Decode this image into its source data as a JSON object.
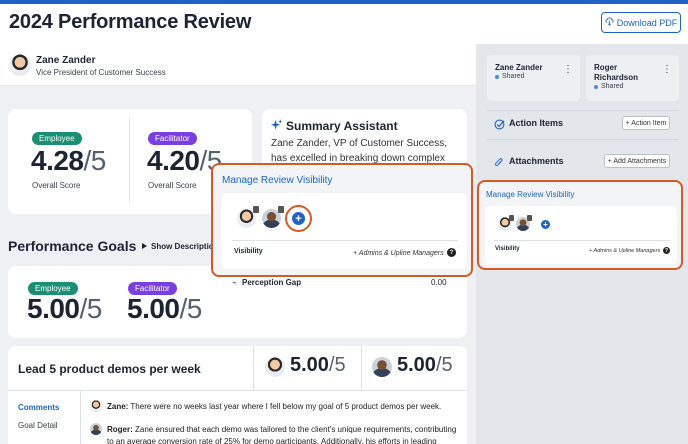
{
  "header": {
    "title": "2024 Performance Review",
    "download_label": "Download PDF"
  },
  "reviewee": {
    "name": "Zane Zander",
    "role": "Vice President of Customer Success"
  },
  "overall": {
    "employee_badge": "Employee",
    "employee_score": "4.28",
    "facilitator_badge": "Facilitator",
    "facilitator_score": "4.20",
    "denominator": "/5",
    "employee_caption": "Overall Score",
    "facilitator_caption": "Overall Score"
  },
  "summary": {
    "title": "Summary Assistant",
    "text": "Zane Zander, VP of Customer Success, has excelled in breaking down complex"
  },
  "goals": {
    "title": "Performance Goals",
    "show_desc_label": "Show Descriptio",
    "employee_badge": "Employee",
    "employee_score": "5.00",
    "facilitator_badge": "Facilitator",
    "facilitator_score": "5.00",
    "denominator": "/5",
    "perception_label": "Perception Gap",
    "perception_value": "0.00"
  },
  "goal_item": {
    "title": "Lead 5 product demos per week",
    "score_a": "5.00",
    "score_b": "5.00",
    "denominator": "/5",
    "tab_comments": "Comments",
    "tab_detail": "Goal Detail",
    "comment1_author": "Zane:",
    "comment1_text": " There were no weeks last year where I fell below my goal of 5 product demos per week.",
    "comment2_author": "Roger:",
    "comment2_text": " Zane ensured that each demo was tailored to the client's unique requirements, contributing to an average conversion rate of 25% for demo participants. Additionally, his efforts in leading"
  },
  "sidebar": {
    "sharer1_name": "Zane Zander",
    "sharer1_status": "Shared",
    "sharer2_name": "Roger Richardson",
    "sharer2_status": "Shared",
    "action_items_label": "Action Items",
    "action_item_btn": "+ Action Item",
    "attachments_label": "Attachments",
    "attachments_btn": "+ Add Attachments"
  },
  "visibility_popup": {
    "title": "Manage Review Visibility",
    "visibility_label": "Visibility",
    "visibility_value": "+ Admins & Upline Managers",
    "help_glyph": "?"
  },
  "visibility_side": {
    "title": "Manage Review Visibility",
    "visibility_label": "Visibility",
    "visibility_value": "+ Admins & Upline Managers",
    "help_glyph": "?"
  },
  "colors": {
    "accent": "#1f63c6",
    "employee": "#1a8f74",
    "facilitator": "#7a3fe0",
    "highlight": "#d55a23"
  }
}
